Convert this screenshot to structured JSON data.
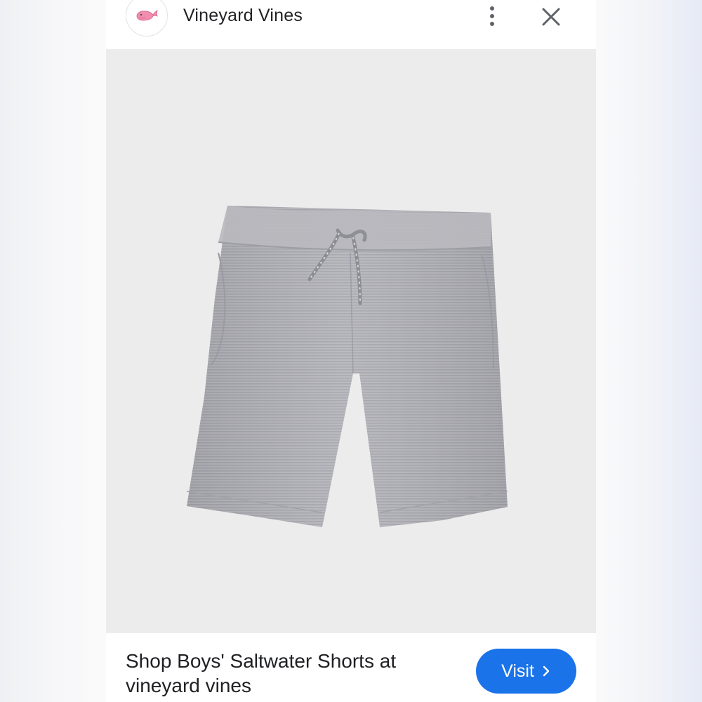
{
  "header": {
    "brand_name": "Vineyard Vines",
    "logo_icon": "pink-whale-logo",
    "menu_icon": "more-vert-icon",
    "close_icon": "close-icon"
  },
  "product": {
    "image_subject": "grey-shorts-with-drawstring"
  },
  "footer": {
    "title": "Shop Boys' Saltwater Shorts at vineyard vines",
    "visit_label": "Visit",
    "visit_icon": "chevron-right-icon"
  },
  "colors": {
    "accent": "#1a73e8",
    "logo_pink": "#f08db0",
    "image_background": "#ececec"
  }
}
